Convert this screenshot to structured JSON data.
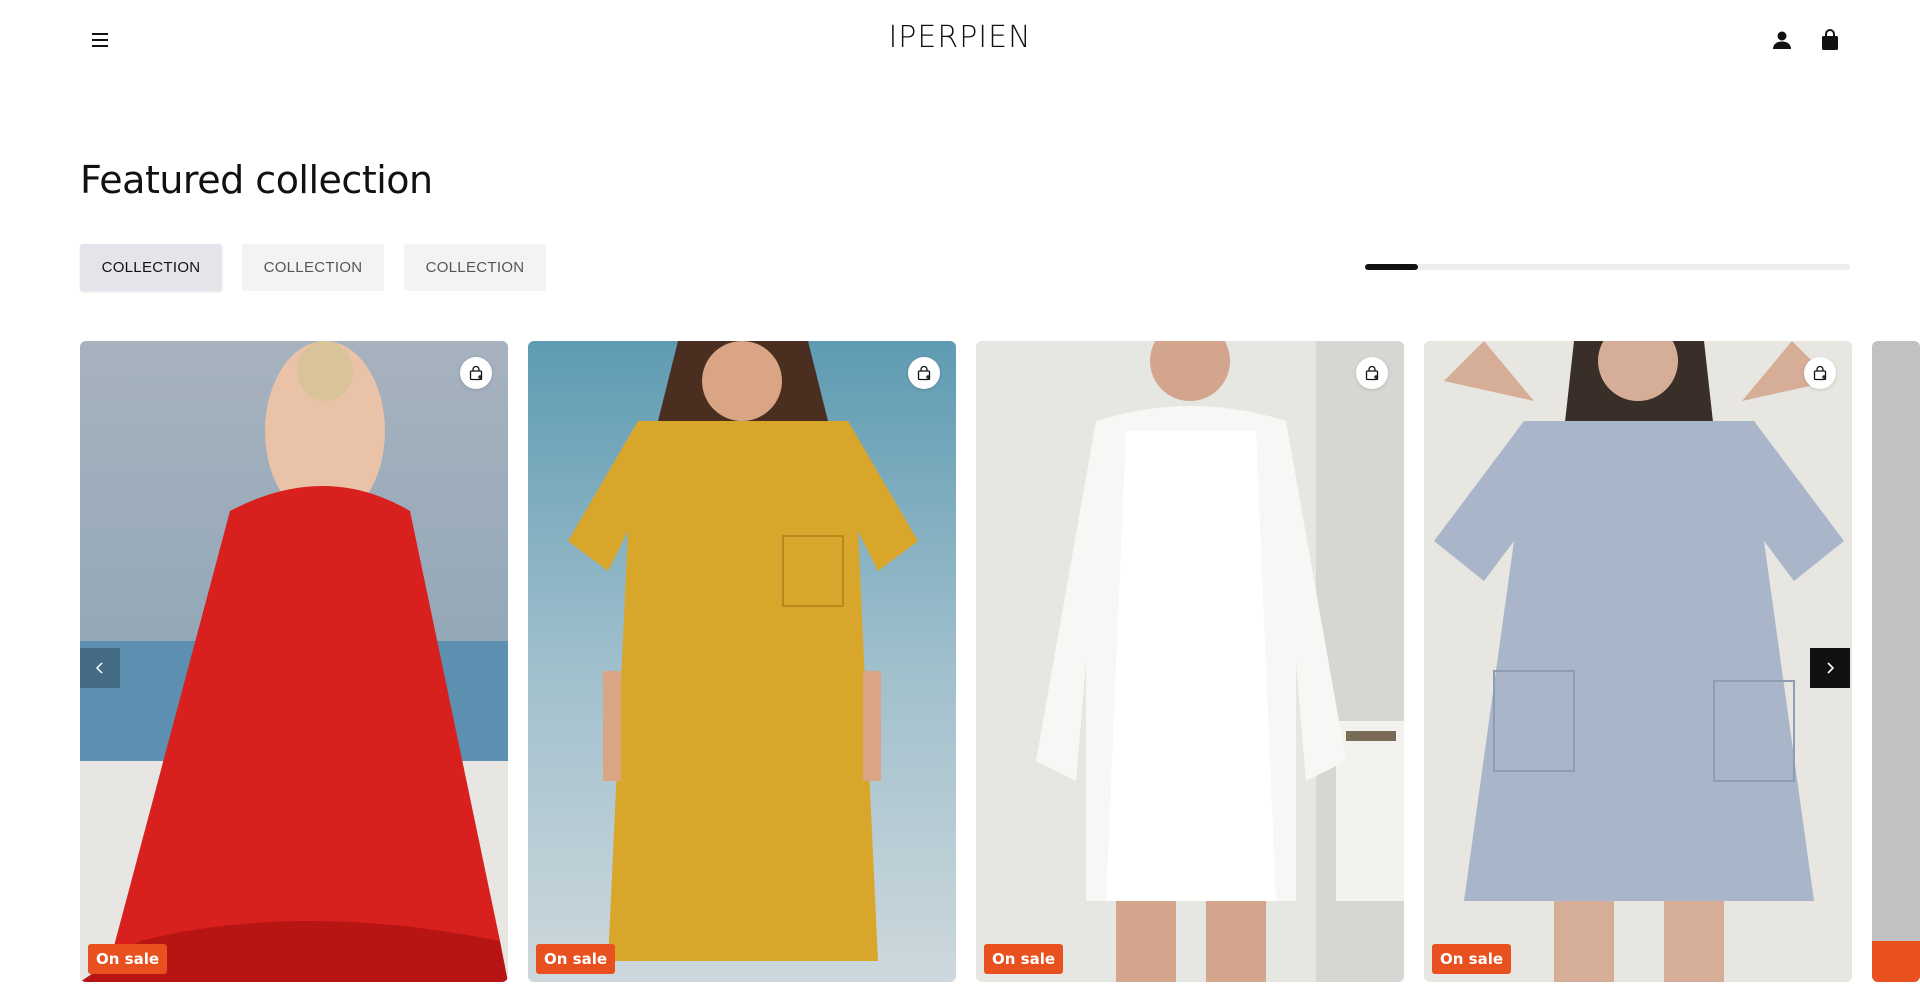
{
  "header": {
    "logo": "IPERPIEN",
    "menu_icon": "hamburger-menu-icon",
    "account_icon": "user-icon",
    "cart_icon": "shopping-bag-icon"
  },
  "section": {
    "title": "Featured collection"
  },
  "tabs": [
    {
      "label": "COLLECTION",
      "active": true
    },
    {
      "label": "COLLECTION",
      "active": false
    },
    {
      "label": "COLLECTION",
      "active": false
    }
  ],
  "carousel": {
    "progress_fraction": 0.11,
    "prev_icon": "chevron-left-icon",
    "next_icon": "chevron-right-icon",
    "products": [
      {
        "image": "red backless maxi dress",
        "badge": "On sale",
        "color": "#d8201e",
        "quick_add_icon": "add-to-bag-icon"
      },
      {
        "image": "mustard linen short-sleeve dress",
        "badge": "On sale",
        "color": "#d9a62c",
        "quick_add_icon": "add-to-bag-icon"
      },
      {
        "image": "white linen layered dress",
        "badge": "On sale",
        "color": "#f4f4f2",
        "quick_add_icon": "add-to-bag-icon"
      },
      {
        "image": "light blue striped linen dress",
        "badge": "On sale",
        "color": "#a9b6c9",
        "quick_add_icon": "add-to-bag-icon"
      }
    ]
  },
  "colors": {
    "sale_badge": "#e8501f",
    "text": "#111111",
    "tab_bg": "#f3f3f5"
  }
}
